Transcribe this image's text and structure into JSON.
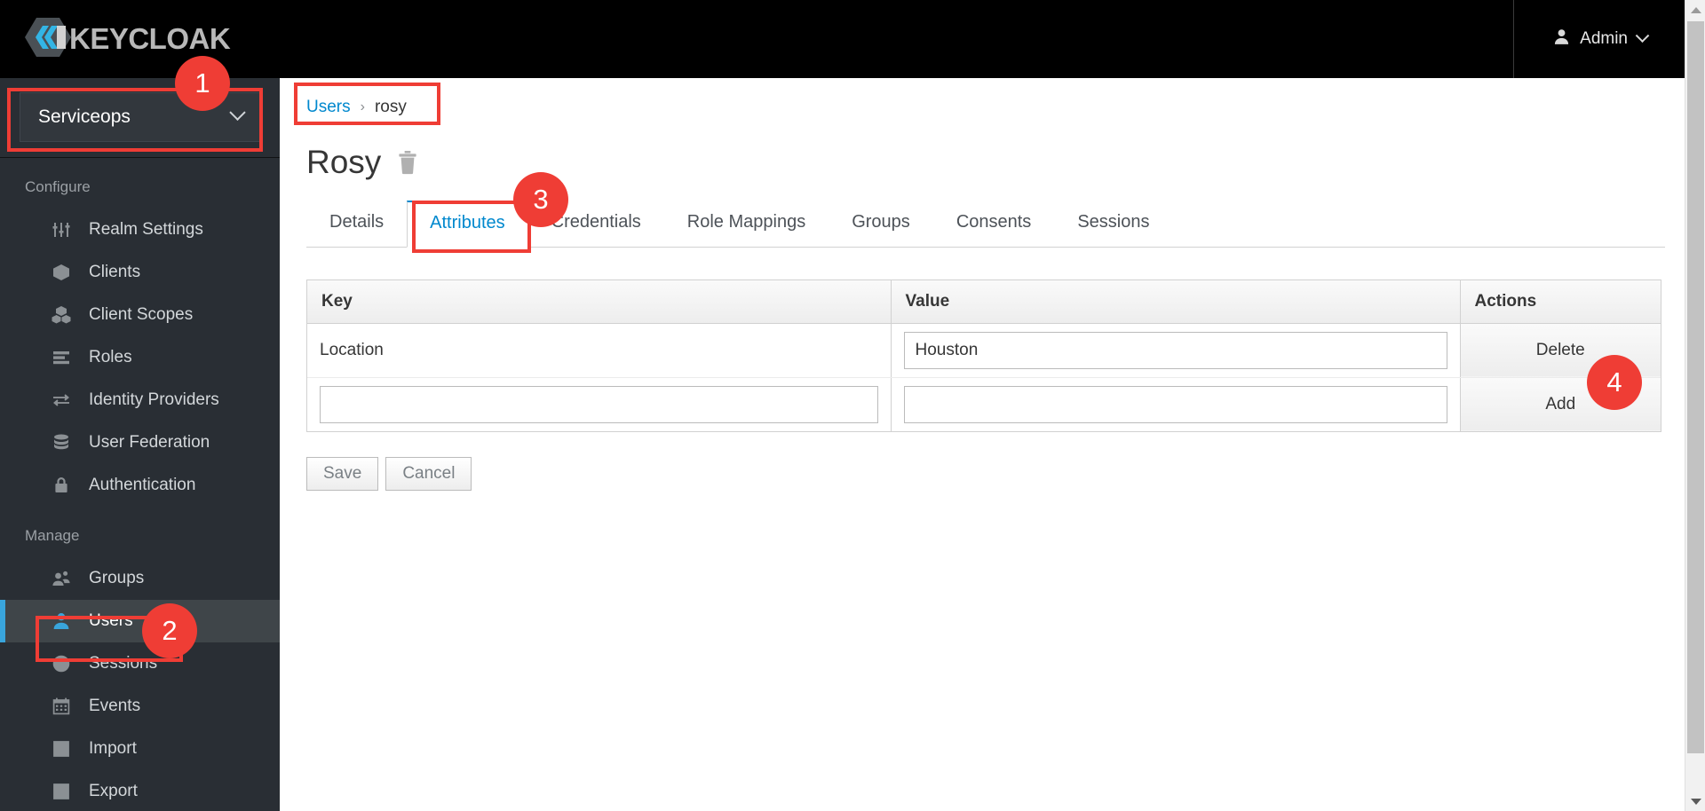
{
  "brand": {
    "name": "KEYCLOAK",
    "logo_icon": "keycloak-logo-icon"
  },
  "topbar": {
    "admin_label": "Admin",
    "admin_icon": "user-icon",
    "admin_caret_icon": "chevron-down-icon"
  },
  "sidebar": {
    "realm": {
      "name": "Serviceops",
      "caret_icon": "chevron-down-icon"
    },
    "sections": [
      {
        "title": "Configure",
        "items": [
          {
            "label": "Realm Settings",
            "icon": "sliders-icon",
            "active": false
          },
          {
            "label": "Clients",
            "icon": "cube-icon",
            "active": false
          },
          {
            "label": "Client Scopes",
            "icon": "cubes-icon",
            "active": false
          },
          {
            "label": "Roles",
            "icon": "list-icon",
            "active": false
          },
          {
            "label": "Identity Providers",
            "icon": "exchange-arrows-icon",
            "active": false
          },
          {
            "label": "User Federation",
            "icon": "database-icon",
            "active": false
          },
          {
            "label": "Authentication",
            "icon": "lock-icon",
            "active": false
          }
        ]
      },
      {
        "title": "Manage",
        "items": [
          {
            "label": "Groups",
            "icon": "users-group-icon",
            "active": false
          },
          {
            "label": "Users",
            "icon": "user-icon",
            "active": true
          },
          {
            "label": "Sessions",
            "icon": "clock-icon",
            "active": false
          },
          {
            "label": "Events",
            "icon": "calendar-icon",
            "active": false
          },
          {
            "label": "Import",
            "icon": "import-arrow-icon",
            "active": false
          },
          {
            "label": "Export",
            "icon": "export-arrow-icon",
            "active": false
          }
        ]
      }
    ]
  },
  "main": {
    "breadcrumb": {
      "parent": "Users",
      "separator": "›",
      "current": "rosy"
    },
    "page_title": "Rosy",
    "delete_user_icon": "trash-icon",
    "tabs": [
      {
        "label": "Details",
        "active": false
      },
      {
        "label": "Attributes",
        "active": true
      },
      {
        "label": "Credentials",
        "active": false
      },
      {
        "label": "Role Mappings",
        "active": false
      },
      {
        "label": "Groups",
        "active": false
      },
      {
        "label": "Consents",
        "active": false
      },
      {
        "label": "Sessions",
        "active": false
      }
    ],
    "attributes_table": {
      "headers": [
        "Key",
        "Value",
        "Actions"
      ],
      "rows": [
        {
          "key": "Location",
          "key_editable": false,
          "key_placeholder": "",
          "value": "Houston",
          "value_placeholder": "",
          "action": "Delete"
        },
        {
          "key": "",
          "key_editable": true,
          "key_placeholder": "",
          "value": "",
          "value_placeholder": "",
          "action": "Add"
        }
      ]
    },
    "buttons": {
      "save": "Save",
      "cancel": "Cancel"
    }
  },
  "scrollbar": {
    "up_icon": "triangle-up-icon",
    "down_icon": "triangle-down-icon"
  },
  "annotations": [
    {
      "number": "1",
      "target": "realm-selector"
    },
    {
      "number": "2",
      "target": "sidebar-item-users"
    },
    {
      "number": "3",
      "target": "tab-attributes"
    },
    {
      "number": "4",
      "target": "add-attribute-action"
    }
  ],
  "colors": {
    "accent_blue": "#0088ce",
    "active_nav_blue": "#39a5dc",
    "annotation_red": "#ef3d35",
    "sidebar_bg": "#292e34",
    "topbar_bg": "#000000"
  }
}
